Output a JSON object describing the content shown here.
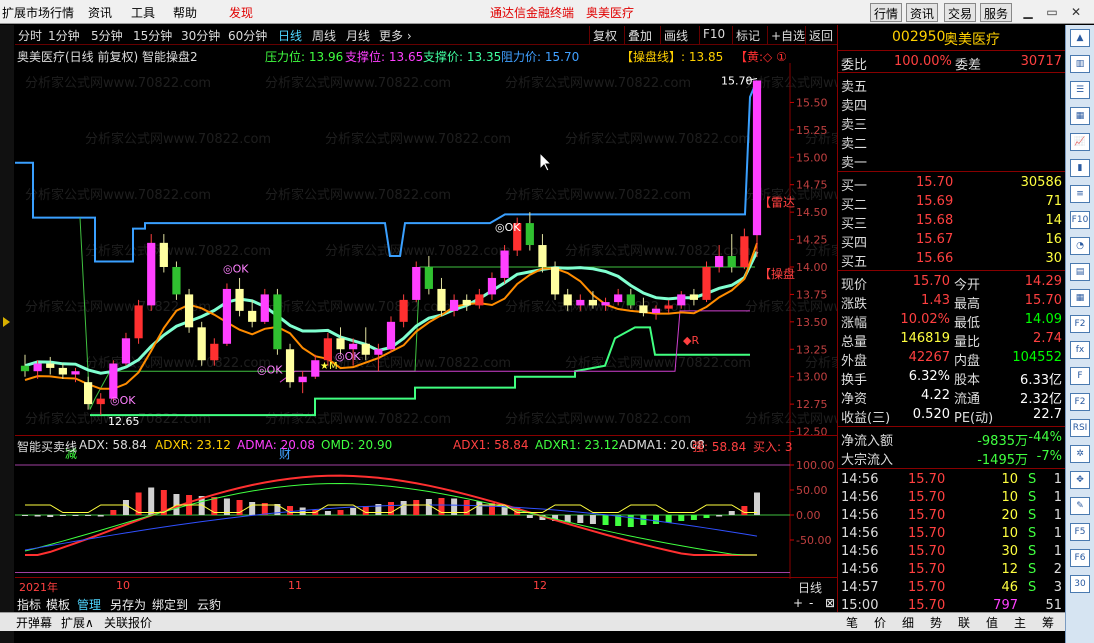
{
  "menu": {
    "items": [
      "扩展市场行情",
      "资讯",
      "工具",
      "帮助",
      "发现"
    ],
    "banner_title": "通达信金融终端",
    "banner_stock": "奥美医疗",
    "right_buttons": [
      "行情",
      "资讯",
      "交易",
      "服务"
    ]
  },
  "timeframes": [
    "分时",
    "1分钟",
    "5分钟",
    "15分钟",
    "30分钟",
    "60分钟",
    "日线",
    "周线",
    "月线",
    "更多"
  ],
  "active_timeframe": "日线",
  "toolbar": [
    "复权",
    "叠加",
    "画线",
    "F10",
    "标记",
    "+自选",
    "返回"
  ],
  "main_chart": {
    "indicator_title": "奥美医疗(日线 前复权) 智能操盘2",
    "pressure": "压力位: 13.96",
    "support_pos": "支撑位: 13.65",
    "support_price": "支撑价: 13.35",
    "resistance": "阻力价: 15.70",
    "operation_line": "【操盘线】: 13.85",
    "yellow_tag": "【黄:◇ ①",
    "price_ticks": [
      "15.50",
      "15.25",
      "15.00",
      "14.75",
      "14.50",
      "14.25",
      "14.00",
      "13.75",
      "13.50",
      "13.25",
      "13.00",
      "12.75",
      "12.50"
    ],
    "high_label": "15.70",
    "low_label": "12.65",
    "tag_leida": "【雷达",
    "tag_caopan": "【操盘",
    "ok_labels": [
      "OK",
      "OK",
      "OK",
      "OK",
      "OK"
    ],
    "r_label": "◆R",
    "star_label": "★M",
    "jian": "减",
    "cai": "财",
    "watermark": "分析家公式网www.70822.com"
  },
  "sub_chart": {
    "title": "智能买卖线",
    "adx": "ADX: 58.84",
    "adxr": "ADXR: 23.12",
    "adma": "ADMA: 20.08",
    "omd": "OMD: 20.90",
    "adx1": "ADX1: 58.84",
    "adxr1": "ADXR1: 23.12",
    "adma1": "ADMA1: 20.08",
    "strong": "强: 58.84",
    "buy": "买入: 3",
    "ticks": [
      "100.00",
      "50.00",
      "0.00",
      "-50.00"
    ]
  },
  "x_axis": {
    "labels": [
      "2021年",
      "10",
      "11",
      "12"
    ],
    "period": "日线"
  },
  "bottom_tabs": [
    "指标",
    "模板",
    "管理",
    "另存为",
    "绑定到",
    "云豹"
  ],
  "status": [
    "开弹幕",
    "扩展∧",
    "关联报价"
  ],
  "quote": {
    "code": "002950",
    "name": "奥美医疗",
    "weibi_label": "委比",
    "weibi": "100.00%",
    "weicha_label": "委差",
    "weicha": "30717",
    "sell": [
      {
        "label": "卖五",
        "price": "",
        "vol": ""
      },
      {
        "label": "卖四",
        "price": "",
        "vol": ""
      },
      {
        "label": "卖三",
        "price": "",
        "vol": ""
      },
      {
        "label": "卖二",
        "price": "",
        "vol": ""
      },
      {
        "label": "卖一",
        "price": "",
        "vol": ""
      }
    ],
    "buy": [
      {
        "label": "买一",
        "price": "15.70",
        "vol": "30586"
      },
      {
        "label": "买二",
        "price": "15.69",
        "vol": "71"
      },
      {
        "label": "买三",
        "price": "15.68",
        "vol": "14"
      },
      {
        "label": "买四",
        "price": "15.67",
        "vol": "16"
      },
      {
        "label": "买五",
        "price": "15.66",
        "vol": "30"
      }
    ],
    "stats": [
      {
        "l1": "现价",
        "v1": "15.70",
        "l2": "今开",
        "v2": "14.29",
        "c1": "#ff4040",
        "c2": "#ff4040"
      },
      {
        "l1": "涨跌",
        "v1": "1.43",
        "l2": "最高",
        "v2": "15.70",
        "c1": "#ff4040",
        "c2": "#ff4040"
      },
      {
        "l1": "涨幅",
        "v1": "10.02%",
        "l2": "最低",
        "v2": "14.09",
        "c1": "#ff4040",
        "c2": "#00ff00"
      },
      {
        "l1": "总量",
        "v1": "146819",
        "l2": "量比",
        "v2": "2.74",
        "c1": "#ffff40",
        "c2": "#ff4040"
      },
      {
        "l1": "外盘",
        "v1": "42267",
        "l2": "内盘",
        "v2": "104552",
        "c1": "#ff4040",
        "c2": "#00ff00"
      },
      {
        "l1": "换手",
        "v1": "6.32%",
        "l2": "股本",
        "v2": "6.33亿",
        "c1": "#ffffff",
        "c2": "#ffffff"
      },
      {
        "l1": "净资",
        "v1": "4.22",
        "l2": "流通",
        "v2": "2.32亿",
        "c1": "#ffffff",
        "c2": "#ffffff"
      },
      {
        "l1": "收益(三)",
        "v1": "0.520",
        "l2": "PE(动)",
        "v2": "22.7",
        "c1": "#ffffff",
        "c2": "#ffffff"
      }
    ],
    "netflow": [
      {
        "label": "净流入额",
        "value": "-9835万",
        "pct": "-44%"
      },
      {
        "label": "大宗流入",
        "value": "-1495万",
        "pct": "-7%"
      }
    ],
    "ticks": [
      {
        "t": "14:56",
        "p": "15.70",
        "v": "10",
        "s": "S",
        "n": "1"
      },
      {
        "t": "14:56",
        "p": "15.70",
        "v": "10",
        "s": "S",
        "n": "1"
      },
      {
        "t": "14:56",
        "p": "15.70",
        "v": "20",
        "s": "S",
        "n": "1"
      },
      {
        "t": "14:56",
        "p": "15.70",
        "v": "10",
        "s": "S",
        "n": "1"
      },
      {
        "t": "14:56",
        "p": "15.70",
        "v": "30",
        "s": "S",
        "n": "1"
      },
      {
        "t": "14:56",
        "p": "15.70",
        "v": "12",
        "s": "S",
        "n": "2"
      },
      {
        "t": "14:57",
        "p": "15.70",
        "v": "46",
        "s": "S",
        "n": "3"
      },
      {
        "t": "15:00",
        "p": "15.70",
        "v": "797",
        "s": "",
        "n": "51"
      }
    ],
    "tabs": [
      "笔",
      "价",
      "细",
      "势",
      "联",
      "值",
      "主",
      "筹"
    ]
  },
  "sidebar_icons": [
    "up",
    "cols",
    "list",
    "grid",
    "chart",
    "bar",
    "rank",
    "F10",
    "pie",
    "doc",
    "grid2",
    "F2",
    "fx",
    "F",
    "F2b",
    "RSI",
    "gear",
    "move",
    "pen",
    "F5",
    "F6",
    "30"
  ],
  "chart_data": {
    "type": "candlestick",
    "ylim": [
      12.35,
      15.75
    ],
    "series": [
      {
        "name": "candles",
        "values": [
          [
            13.1,
            13.2,
            13.0,
            13.05
          ],
          [
            13.05,
            13.15,
            12.98,
            13.12
          ],
          [
            13.12,
            13.18,
            13.02,
            13.08
          ],
          [
            13.08,
            13.12,
            12.98,
            13.02
          ],
          [
            13.02,
            13.08,
            12.95,
            13.05
          ],
          [
            12.95,
            13.0,
            12.7,
            12.75
          ],
          [
            12.75,
            12.85,
            12.65,
            12.8
          ],
          [
            12.8,
            13.15,
            12.78,
            13.12
          ],
          [
            13.12,
            13.4,
            13.1,
            13.35
          ],
          [
            13.35,
            13.7,
            13.3,
            13.65
          ],
          [
            13.65,
            14.3,
            13.6,
            14.22
          ],
          [
            14.22,
            14.3,
            13.95,
            14.0
          ],
          [
            14.0,
            14.05,
            13.7,
            13.75
          ],
          [
            13.75,
            13.8,
            13.4,
            13.45
          ],
          [
            13.45,
            13.5,
            13.1,
            13.15
          ],
          [
            13.15,
            13.35,
            13.1,
            13.3
          ],
          [
            13.3,
            13.85,
            13.28,
            13.8
          ],
          [
            13.8,
            13.9,
            13.55,
            13.6
          ],
          [
            13.6,
            13.7,
            13.45,
            13.5
          ],
          [
            13.5,
            13.8,
            13.48,
            13.75
          ],
          [
            13.75,
            13.8,
            13.2,
            13.25
          ],
          [
            13.25,
            13.3,
            12.9,
            12.95
          ],
          [
            12.95,
            13.05,
            12.85,
            13.0
          ],
          [
            13.0,
            13.2,
            12.98,
            13.15
          ],
          [
            13.15,
            13.4,
            13.1,
            13.35
          ],
          [
            13.35,
            13.45,
            13.2,
            13.25
          ],
          [
            13.25,
            13.35,
            13.1,
            13.3
          ],
          [
            13.3,
            13.45,
            13.15,
            13.2
          ],
          [
            13.2,
            13.3,
            13.05,
            13.25
          ],
          [
            13.25,
            13.55,
            13.22,
            13.5
          ],
          [
            13.5,
            13.75,
            13.45,
            13.7
          ],
          [
            13.7,
            14.05,
            13.68,
            14.0
          ],
          [
            14.0,
            14.1,
            13.75,
            13.8
          ],
          [
            13.8,
            13.9,
            13.55,
            13.6
          ],
          [
            13.6,
            13.75,
            13.55,
            13.7
          ],
          [
            13.7,
            13.75,
            13.6,
            13.65
          ],
          [
            13.65,
            13.8,
            13.62,
            13.75
          ],
          [
            13.75,
            13.95,
            13.7,
            13.9
          ],
          [
            13.9,
            14.2,
            13.85,
            14.15
          ],
          [
            14.15,
            14.45,
            14.1,
            14.4
          ],
          [
            14.4,
            14.5,
            14.15,
            14.2
          ],
          [
            14.2,
            14.3,
            13.95,
            14.0
          ],
          [
            14.0,
            14.05,
            13.7,
            13.75
          ],
          [
            13.75,
            13.8,
            13.6,
            13.65
          ],
          [
            13.65,
            13.75,
            13.6,
            13.7
          ],
          [
            13.7,
            13.78,
            13.62,
            13.65
          ],
          [
            13.65,
            13.72,
            13.6,
            13.68
          ],
          [
            13.68,
            13.8,
            13.65,
            13.75
          ],
          [
            13.75,
            13.8,
            13.62,
            13.65
          ],
          [
            13.65,
            13.72,
            13.55,
            13.58
          ],
          [
            13.58,
            13.65,
            13.52,
            13.62
          ],
          [
            13.62,
            13.7,
            13.58,
            13.65
          ],
          [
            13.65,
            13.78,
            13.62,
            13.75
          ],
          [
            13.75,
            13.8,
            13.65,
            13.7
          ],
          [
            13.7,
            14.05,
            13.68,
            14.0
          ],
          [
            14.0,
            14.2,
            13.95,
            14.1
          ],
          [
            14.1,
            14.3,
            13.95,
            14.0
          ],
          [
            14.0,
            14.35,
            13.98,
            14.28
          ],
          [
            14.29,
            15.7,
            14.09,
            15.7
          ]
        ]
      }
    ]
  }
}
